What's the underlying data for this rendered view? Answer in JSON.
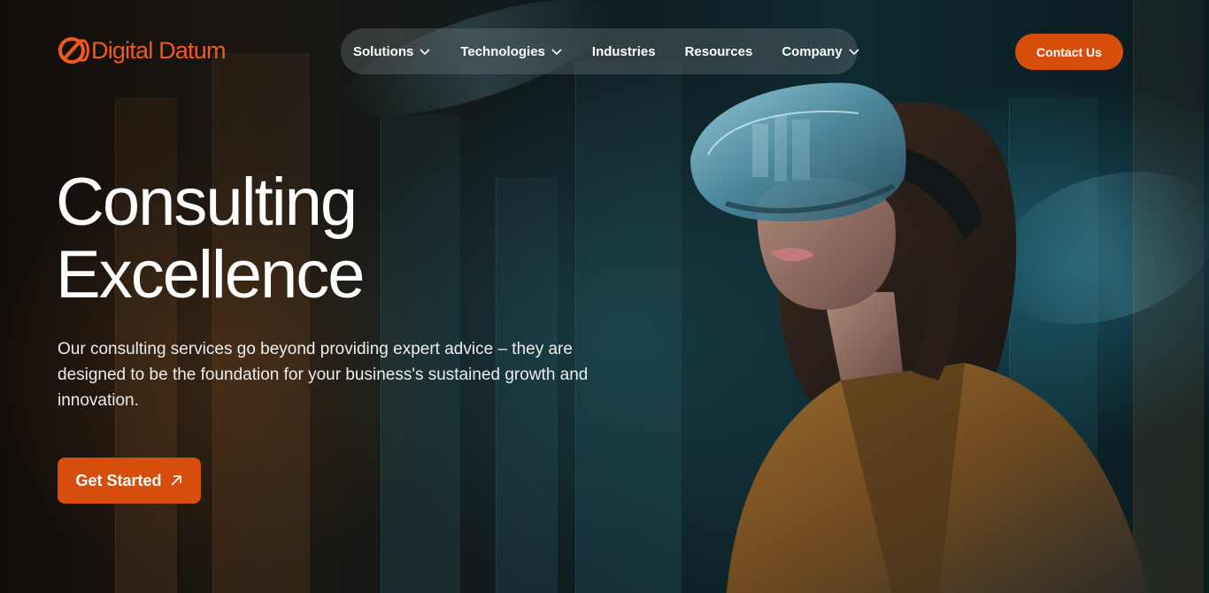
{
  "brand": {
    "name": "Digital Datum",
    "accent": "#d64d0c",
    "logo_color": "#f05a1e"
  },
  "nav": {
    "items": [
      {
        "label": "Solutions",
        "has_dropdown": true,
        "icon": "chevron-down-icon"
      },
      {
        "label": "Technologies",
        "has_dropdown": true,
        "icon": "chevron-down-icon"
      },
      {
        "label": "Industries",
        "has_dropdown": false
      },
      {
        "label": "Resources",
        "has_dropdown": false
      },
      {
        "label": "Company",
        "has_dropdown": true,
        "icon": "chevron-down-icon"
      }
    ],
    "contact_label": "Contact Us"
  },
  "hero": {
    "title_line1": "Consulting",
    "title_line2": "Excellence",
    "description": "Our consulting services go beyond providing expert advice – they are designed to be the foundation for your business's sustained growth and innovation.",
    "cta_label": "Get Started",
    "cta_icon": "arrow-up-right-icon",
    "image": "woman-wearing-vr-headset"
  }
}
